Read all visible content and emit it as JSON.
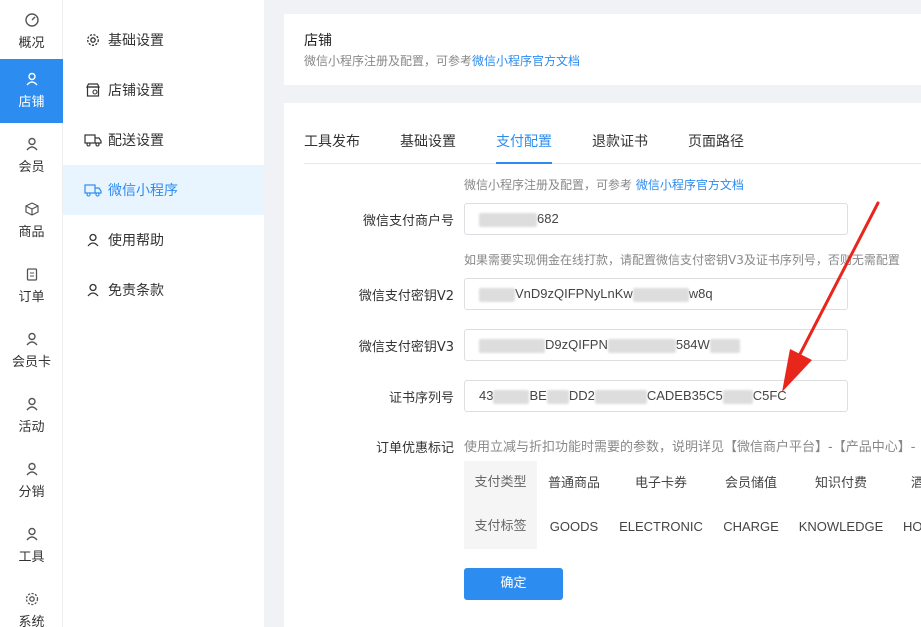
{
  "rail": {
    "items": [
      {
        "label": "概况",
        "icon": "dashboard-icon"
      },
      {
        "label": "店铺",
        "icon": "user-icon",
        "active": true
      },
      {
        "label": "会员",
        "icon": "user-icon"
      },
      {
        "label": "商品",
        "icon": "box-icon"
      },
      {
        "label": "订单",
        "icon": "clipboard-icon"
      },
      {
        "label": "会员卡",
        "icon": "user-icon"
      },
      {
        "label": "活动",
        "icon": "user-icon"
      },
      {
        "label": "分销",
        "icon": "user-icon"
      },
      {
        "label": "工具",
        "icon": "user-icon"
      },
      {
        "label": "系统",
        "icon": "gear-icon"
      }
    ]
  },
  "submenu": {
    "items": [
      {
        "label": "基础设置",
        "icon": "gear-icon"
      },
      {
        "label": "店铺设置",
        "icon": "store-icon"
      },
      {
        "label": "配送设置",
        "icon": "truck-icon"
      },
      {
        "label": "微信小程序",
        "icon": "truck-icon",
        "active": true
      },
      {
        "label": "使用帮助",
        "icon": "user-icon"
      },
      {
        "label": "免责条款",
        "icon": "user-icon"
      }
    ]
  },
  "header": {
    "title": "店铺",
    "desc_prefix": "微信小程序注册及配置，可参考",
    "desc_link": "微信小程序官方文档"
  },
  "tabs": [
    {
      "label": "工具发布"
    },
    {
      "label": "基础设置"
    },
    {
      "label": "支付配置",
      "active": true
    },
    {
      "label": "退款证书"
    },
    {
      "label": "页面路径"
    }
  ],
  "form": {
    "top_hint_prefix": "微信小程序注册及配置，可参考",
    "top_hint_link": "微信小程序官方文档",
    "merchant_id_label": "微信支付商户号",
    "merchant_id_suffix": "682",
    "v3_hint": "如果需要实现佣金在线打款，请配置微信支付密钥V3及证书序列号，否则无需配置",
    "key_v2_label": "微信支付密钥V2",
    "key_v2_part1": "VnD9zQIFPNyLnKw",
    "key_v2_part2": "w8q",
    "key_v3_label": "微信支付密钥V3",
    "key_v3_part1": "D9zQIFPN",
    "key_v3_part2": "584W",
    "cert_label": "证书序列号",
    "cert_part1": "43",
    "cert_part2": "BE",
    "cert_part3": "DD2",
    "cert_part4": "CADEB35C5",
    "cert_part5": "C5FC",
    "discount_label": "订单优惠标记",
    "discount_hint": "使用立减与折扣功能时需要的参数，说明详见【微信商户平台】-【产品中心】-"
  },
  "discount_table": {
    "row1_header": "支付类型",
    "row2_header": "支付标签",
    "types": [
      "普通商品",
      "电子卡券",
      "会员储值",
      "知识付费",
      "酒"
    ],
    "tags": [
      "GOODS",
      "ELECTRONIC",
      "CHARGE",
      "KNOWLEDGE",
      "HO"
    ]
  },
  "confirm_button": "确定",
  "colors": {
    "accent": "#2d8cf0",
    "arrow": "#e8261c"
  }
}
